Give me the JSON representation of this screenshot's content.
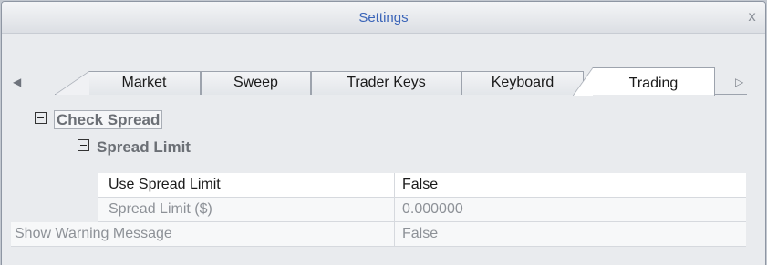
{
  "window": {
    "title": "Settings",
    "close_glyph": "x"
  },
  "tabs": {
    "scroll_left_glyph": "◀",
    "scroll_right_glyph": "▷",
    "items": [
      {
        "label": "Market"
      },
      {
        "label": "Sweep"
      },
      {
        "label": "Trader Keys"
      },
      {
        "label": "Keyboard"
      },
      {
        "label": "Trading",
        "active": true
      }
    ]
  },
  "grid": {
    "category": {
      "label": "Check Spread",
      "expanded": true
    },
    "subcategory": {
      "label": "Spread Limit",
      "expanded": true
    },
    "rows": [
      {
        "name": "Use Spread Limit",
        "value": "False",
        "enabled": true
      },
      {
        "name": "Spread Limit ($)",
        "value": "0.000000",
        "enabled": false
      },
      {
        "name": "Show Warning Message",
        "value": "False",
        "enabled": false
      }
    ]
  },
  "colors": {
    "title": "#3a64b8",
    "disabled_text": "#8d9197",
    "window_bg": "#e9ebee"
  }
}
